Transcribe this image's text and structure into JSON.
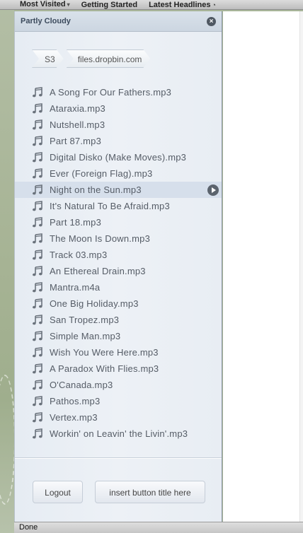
{
  "bookmarks": [
    {
      "label": "Most Visited",
      "icon": "chevron-down-icon"
    },
    {
      "label": "Getting Started"
    },
    {
      "label": "Latest Headlines",
      "icon": "rss-icon"
    }
  ],
  "sidebar": {
    "title": "Partly Cloudy",
    "breadcrumb": [
      "S3",
      "files.dropbin.com"
    ],
    "files": [
      {
        "name": "A Song For Our Fathers.mp3",
        "icon": "music-note-icon"
      },
      {
        "name": "Ataraxia.mp3",
        "icon": "music-note-icon"
      },
      {
        "name": "Nutshell.mp3",
        "icon": "music-note-icon"
      },
      {
        "name": "Part 87.mp3",
        "icon": "music-note-icon"
      },
      {
        "name": "Digital Disko (Make Moves).mp3",
        "icon": "music-note-icon"
      },
      {
        "name": "Ever (Foreign Flag).mp3",
        "icon": "music-note-icon"
      },
      {
        "name": "Night on the Sun.mp3",
        "icon": "music-note-icon",
        "selected": true
      },
      {
        "name": "It's Natural To Be Afraid.mp3",
        "icon": "music-note-icon"
      },
      {
        "name": "Part 18.mp3",
        "icon": "music-note-icon"
      },
      {
        "name": "The Moon Is Down.mp3",
        "icon": "music-note-icon"
      },
      {
        "name": "Track 03.mp3",
        "icon": "music-note-icon"
      },
      {
        "name": "An Ethereal Drain.mp3",
        "icon": "music-note-icon"
      },
      {
        "name": "Mantra.m4a",
        "icon": "music-note-icon"
      },
      {
        "name": "One Big Holiday.mp3",
        "icon": "music-note-icon"
      },
      {
        "name": "San Tropez.mp3",
        "icon": "music-note-icon"
      },
      {
        "name": "Simple Man.mp3",
        "icon": "music-note-icon"
      },
      {
        "name": "Wish You Were Here.mp3",
        "icon": "music-note-icon"
      },
      {
        "name": "A Paradox With Flies.mp3",
        "icon": "music-note-icon"
      },
      {
        "name": "O'Canada.mp3",
        "icon": "music-note-icon"
      },
      {
        "name": "Pathos.mp3",
        "icon": "music-note-icon"
      },
      {
        "name": "Vertex.mp3",
        "icon": "music-note-icon"
      },
      {
        "name": "Workin' on Leavin' the Livin'.mp3",
        "icon": "music-note-icon"
      }
    ],
    "buttons": {
      "logout": "Logout",
      "insert": "insert button title here"
    }
  },
  "statusbar": {
    "text": "Done"
  },
  "colors": {
    "panel_bg": "#e9eef4",
    "selected_row": "#d6dfeb",
    "title_text": "#3b4a5c"
  }
}
